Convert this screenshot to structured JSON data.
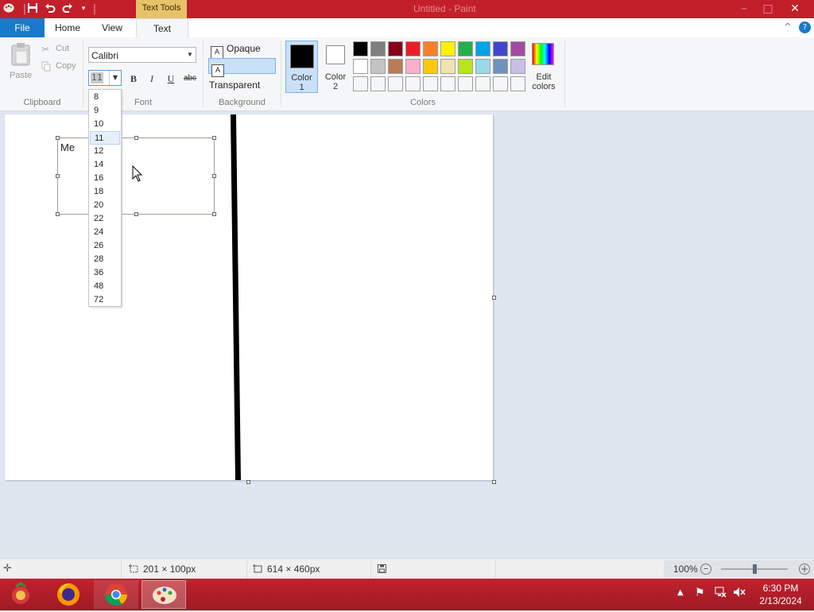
{
  "window": {
    "title": "Untitled - Paint",
    "contextual_tab": "Text Tools"
  },
  "tabs": {
    "file": "File",
    "home": "Home",
    "view": "View",
    "text": "Text"
  },
  "clipboard": {
    "paste": "Paste",
    "cut": "Cut",
    "copy": "Copy",
    "group": "Clipboard"
  },
  "font": {
    "name": "Calibri",
    "size": "11",
    "bold": "B",
    "italic": "I",
    "underline": "U",
    "strike": "abc",
    "group": "Font"
  },
  "background": {
    "opaque": "Opaque",
    "transparent": "Transparent",
    "group": "Background",
    "selected": "Transparent"
  },
  "colors": {
    "color1_line1": "Color",
    "color1_line2": "1",
    "color2_line1": "Color",
    "color2_line2": "2",
    "edit_line1": "Edit",
    "edit_line2": "colors",
    "group": "Colors",
    "color1": "#000000",
    "color2": "#ffffff",
    "palette_row1": [
      "#000000",
      "#7f7f7f",
      "#880015",
      "#ed1c24",
      "#ff7f27",
      "#fff200",
      "#22b14c",
      "#00a2e8",
      "#3f48cc",
      "#a349a4"
    ],
    "palette_row2": [
      "#ffffff",
      "#c3c3c3",
      "#b97a57",
      "#ffaec9",
      "#ffc90e",
      "#efe4b0",
      "#b5e61d",
      "#99d9ea",
      "#7092be",
      "#c8bfe7"
    ],
    "palette_row3": [
      "#f5f6f7",
      "#f5f6f7",
      "#f5f6f7",
      "#f5f6f7",
      "#f5f6f7",
      "#f5f6f7",
      "#f5f6f7",
      "#f5f6f7",
      "#f5f6f7",
      "#f5f6f7"
    ]
  },
  "font_size_options": [
    "8",
    "9",
    "10",
    "11",
    "12",
    "14",
    "16",
    "18",
    "20",
    "22",
    "24",
    "26",
    "28",
    "36",
    "48",
    "72"
  ],
  "font_size_selected": "11",
  "canvas": {
    "text_content": "Me"
  },
  "status": {
    "selection_size": "201 × 100px",
    "canvas_size": "614 × 460px",
    "zoom": "100%"
  },
  "taskbar": {
    "time": "6:30 PM",
    "date": "2/13/2024"
  }
}
